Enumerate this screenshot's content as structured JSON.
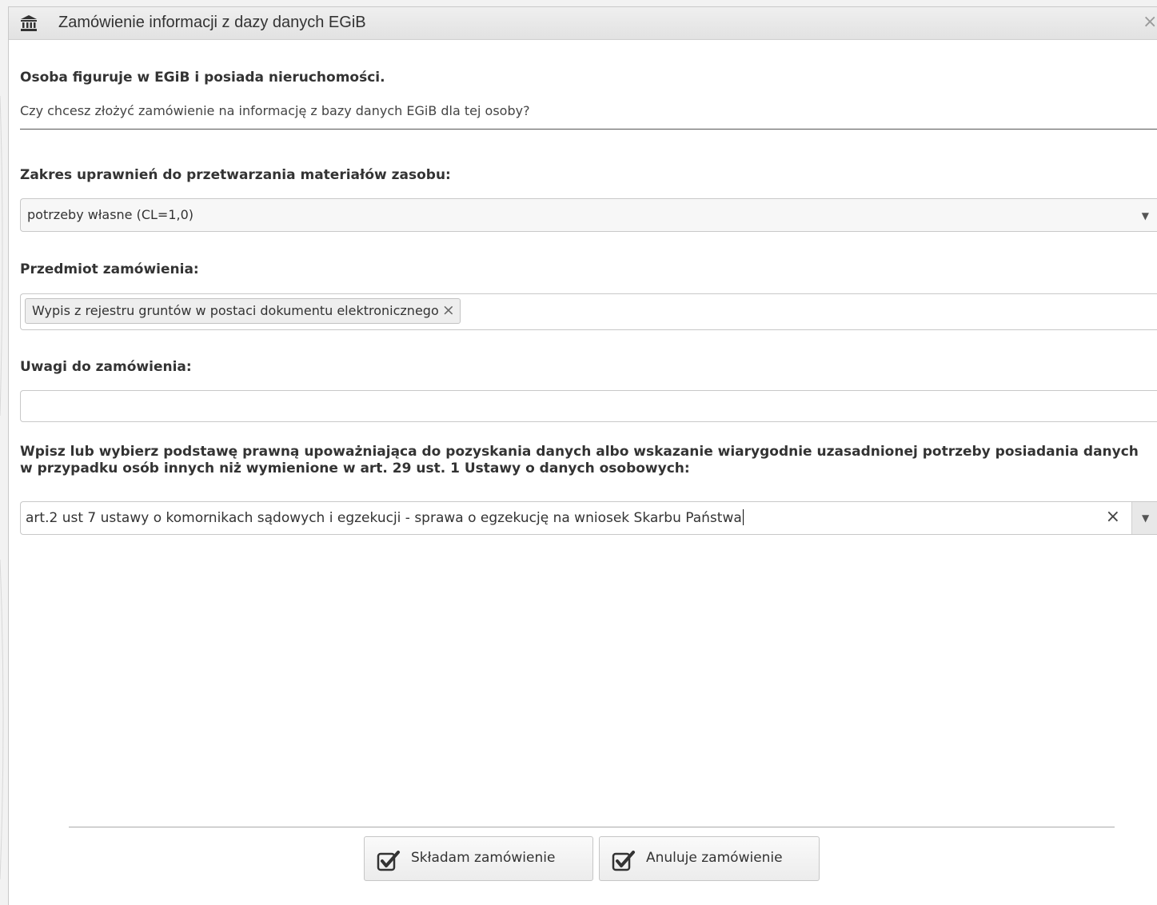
{
  "dialog": {
    "title": "Zamówienie informacji z dazy danych EGiB",
    "close_symbol": "×",
    "title_icon": "bank-building-icon"
  },
  "intro": {
    "heading": "Osoba figuruje w EGiB i posiada nieruchomości.",
    "question": "Czy chcesz złożyć zamówienie na informację z bazy danych EGiB dla tej osoby?"
  },
  "scope": {
    "label": "Zakres uprawnień do przetwarzania materiałów zasobu:",
    "selected": "potrzeby własne (CL=1,0)",
    "arrow": "▼"
  },
  "subject": {
    "label": "Przedmiot zamówienia:",
    "tags": [
      "Wypis z rejestru gruntów w postaci dokumentu elektronicznego"
    ],
    "remove_symbol": "×"
  },
  "notes": {
    "label": "Uwagi do zamówienia:",
    "value": ""
  },
  "legal_basis": {
    "label": "Wpisz lub wybierz podstawę prawną upoważniająca do pozyskania danych albo wskazanie wiarygodnie uzasadnionej potrzeby posiadania danych w przypadku osób innych niż wymienione w art. 29 ust. 1 Ustawy o danych osobowych:",
    "value": "art.2 ust 7 ustawy o komornikach sądowych i egzekucji - sprawa o egzekucję na wniosek Skarbu Państwa",
    "clear_symbol": "×",
    "arrow": "▼"
  },
  "buttons": {
    "submit": "Składam zamówienie",
    "cancel": "Anuluje zamówienie",
    "icon": "check-square-icon"
  }
}
